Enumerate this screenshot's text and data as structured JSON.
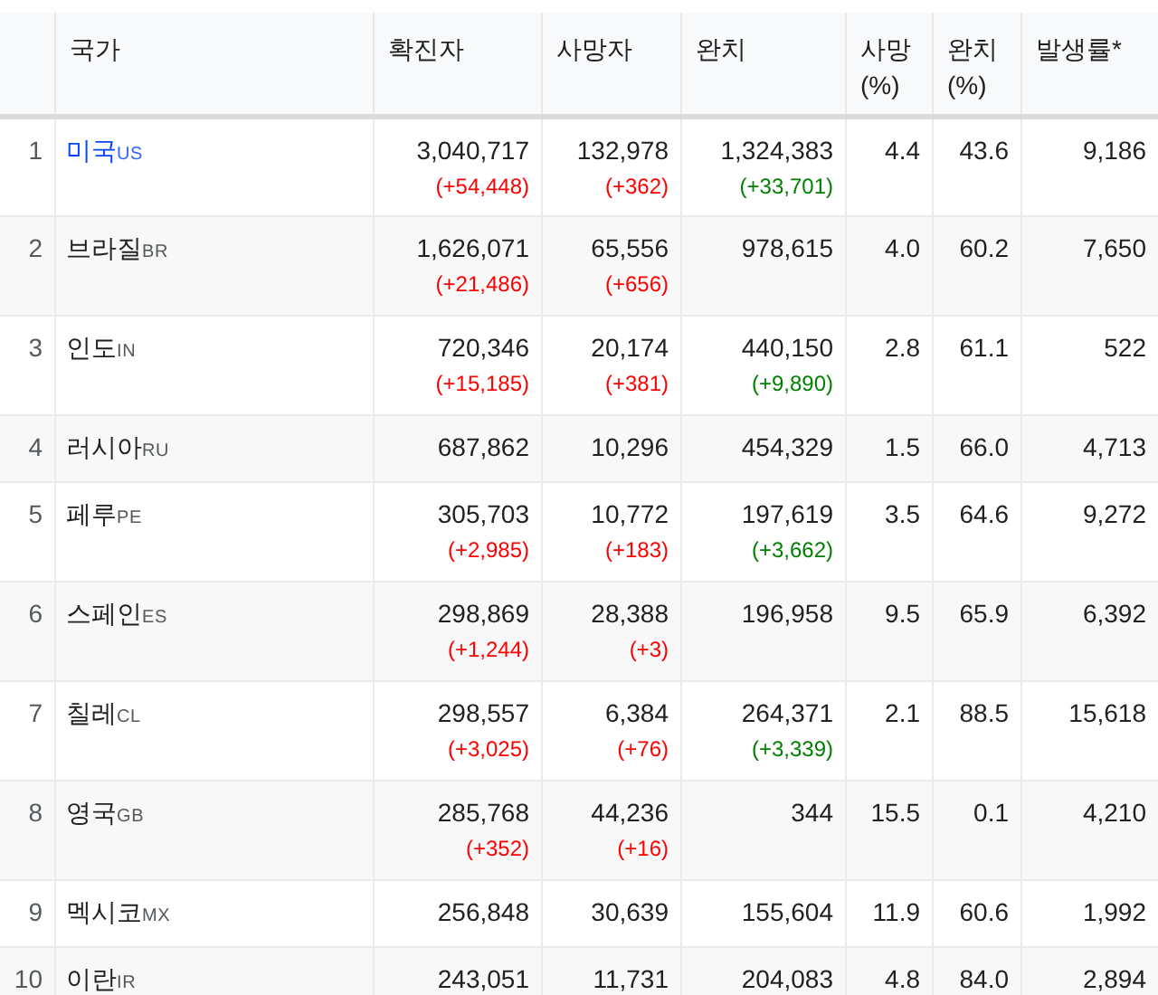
{
  "table": {
    "columns": [
      "",
      "국가",
      "확진자",
      "사망자",
      "완치",
      "사망 (%)",
      "완치 (%)",
      "발생률*"
    ],
    "rows": [
      {
        "rank": "1",
        "country": "미국",
        "code": "US",
        "link": true,
        "confirmed": "3,040,717",
        "confirmed_delta": "(+54,448)",
        "deaths": "132,978",
        "deaths_delta": "(+362)",
        "recovered": "1,324,383",
        "recovered_delta": "(+33,701)",
        "death_pct": "4.4",
        "recovered_pct": "43.6",
        "rate": "9,186"
      },
      {
        "rank": "2",
        "country": "브라질",
        "code": "BR",
        "link": false,
        "confirmed": "1,626,071",
        "confirmed_delta": "(+21,486)",
        "deaths": "65,556",
        "deaths_delta": "(+656)",
        "recovered": "978,615",
        "death_pct": "4.0",
        "recovered_pct": "60.2",
        "rate": "7,650"
      },
      {
        "rank": "3",
        "country": "인도",
        "code": "IN",
        "link": false,
        "confirmed": "720,346",
        "confirmed_delta": "(+15,185)",
        "deaths": "20,174",
        "deaths_delta": "(+381)",
        "recovered": "440,150",
        "recovered_delta": "(+9,890)",
        "death_pct": "2.8",
        "recovered_pct": "61.1",
        "rate": "522"
      },
      {
        "rank": "4",
        "country": "러시아",
        "code": "RU",
        "link": false,
        "confirmed": "687,862",
        "deaths": "10,296",
        "recovered": "454,329",
        "death_pct": "1.5",
        "recovered_pct": "66.0",
        "rate": "4,713"
      },
      {
        "rank": "5",
        "country": "페루",
        "code": "PE",
        "link": false,
        "confirmed": "305,703",
        "confirmed_delta": "(+2,985)",
        "deaths": "10,772",
        "deaths_delta": "(+183)",
        "recovered": "197,619",
        "recovered_delta": "(+3,662)",
        "death_pct": "3.5",
        "recovered_pct": "64.6",
        "rate": "9,272"
      },
      {
        "rank": "6",
        "country": "스페인",
        "code": "ES",
        "link": false,
        "confirmed": "298,869",
        "confirmed_delta": "(+1,244)",
        "deaths": "28,388",
        "deaths_delta": "(+3)",
        "recovered": "196,958",
        "death_pct": "9.5",
        "recovered_pct": "65.9",
        "rate": "6,392"
      },
      {
        "rank": "7",
        "country": "칠레",
        "code": "CL",
        "link": false,
        "confirmed": "298,557",
        "confirmed_delta": "(+3,025)",
        "deaths": "6,384",
        "deaths_delta": "(+76)",
        "recovered": "264,371",
        "recovered_delta": "(+3,339)",
        "death_pct": "2.1",
        "recovered_pct": "88.5",
        "rate": "15,618"
      },
      {
        "rank": "8",
        "country": "영국",
        "code": "GB",
        "link": false,
        "confirmed": "285,768",
        "confirmed_delta": "(+352)",
        "deaths": "44,236",
        "deaths_delta": "(+16)",
        "recovered": "344",
        "death_pct": "15.5",
        "recovered_pct": "0.1",
        "rate": "4,210"
      },
      {
        "rank": "9",
        "country": "멕시코",
        "code": "MX",
        "link": false,
        "confirmed": "256,848",
        "deaths": "30,639",
        "recovered": "155,604",
        "death_pct": "11.9",
        "recovered_pct": "60.6",
        "rate": "1,992"
      },
      {
        "rank": "10",
        "country": "이란",
        "code": "IR",
        "link": false,
        "confirmed": "243,051",
        "deaths": "11,731",
        "recovered": "204,083",
        "death_pct": "4.8",
        "recovered_pct": "84.0",
        "rate": "2,894"
      }
    ]
  }
}
